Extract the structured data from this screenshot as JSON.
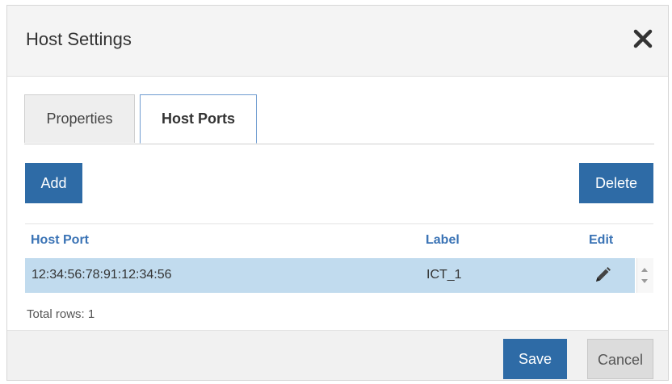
{
  "dialog": {
    "title": "Host Settings",
    "close_icon": "close-x-icon"
  },
  "tabs": [
    {
      "label": "Properties",
      "active": false
    },
    {
      "label": "Host Ports",
      "active": true
    }
  ],
  "toolbar": {
    "add_label": "Add",
    "delete_label": "Delete"
  },
  "table": {
    "columns": [
      "Host Port",
      "Label",
      "Edit"
    ],
    "rows": [
      {
        "host_port": "12:34:56:78:91:12:34:56",
        "label": "ICT_1",
        "edit_icon": "pencil-icon",
        "selected": true
      }
    ],
    "total_rows": "Total rows: 1"
  },
  "footer": {
    "save_label": "Save",
    "cancel_label": "Cancel"
  },
  "colors": {
    "primary_button": "#2e6ba6",
    "column_header": "#3a73b5",
    "selected_row": "#c1dbee",
    "active_tab_border": "#6e9bd0"
  }
}
